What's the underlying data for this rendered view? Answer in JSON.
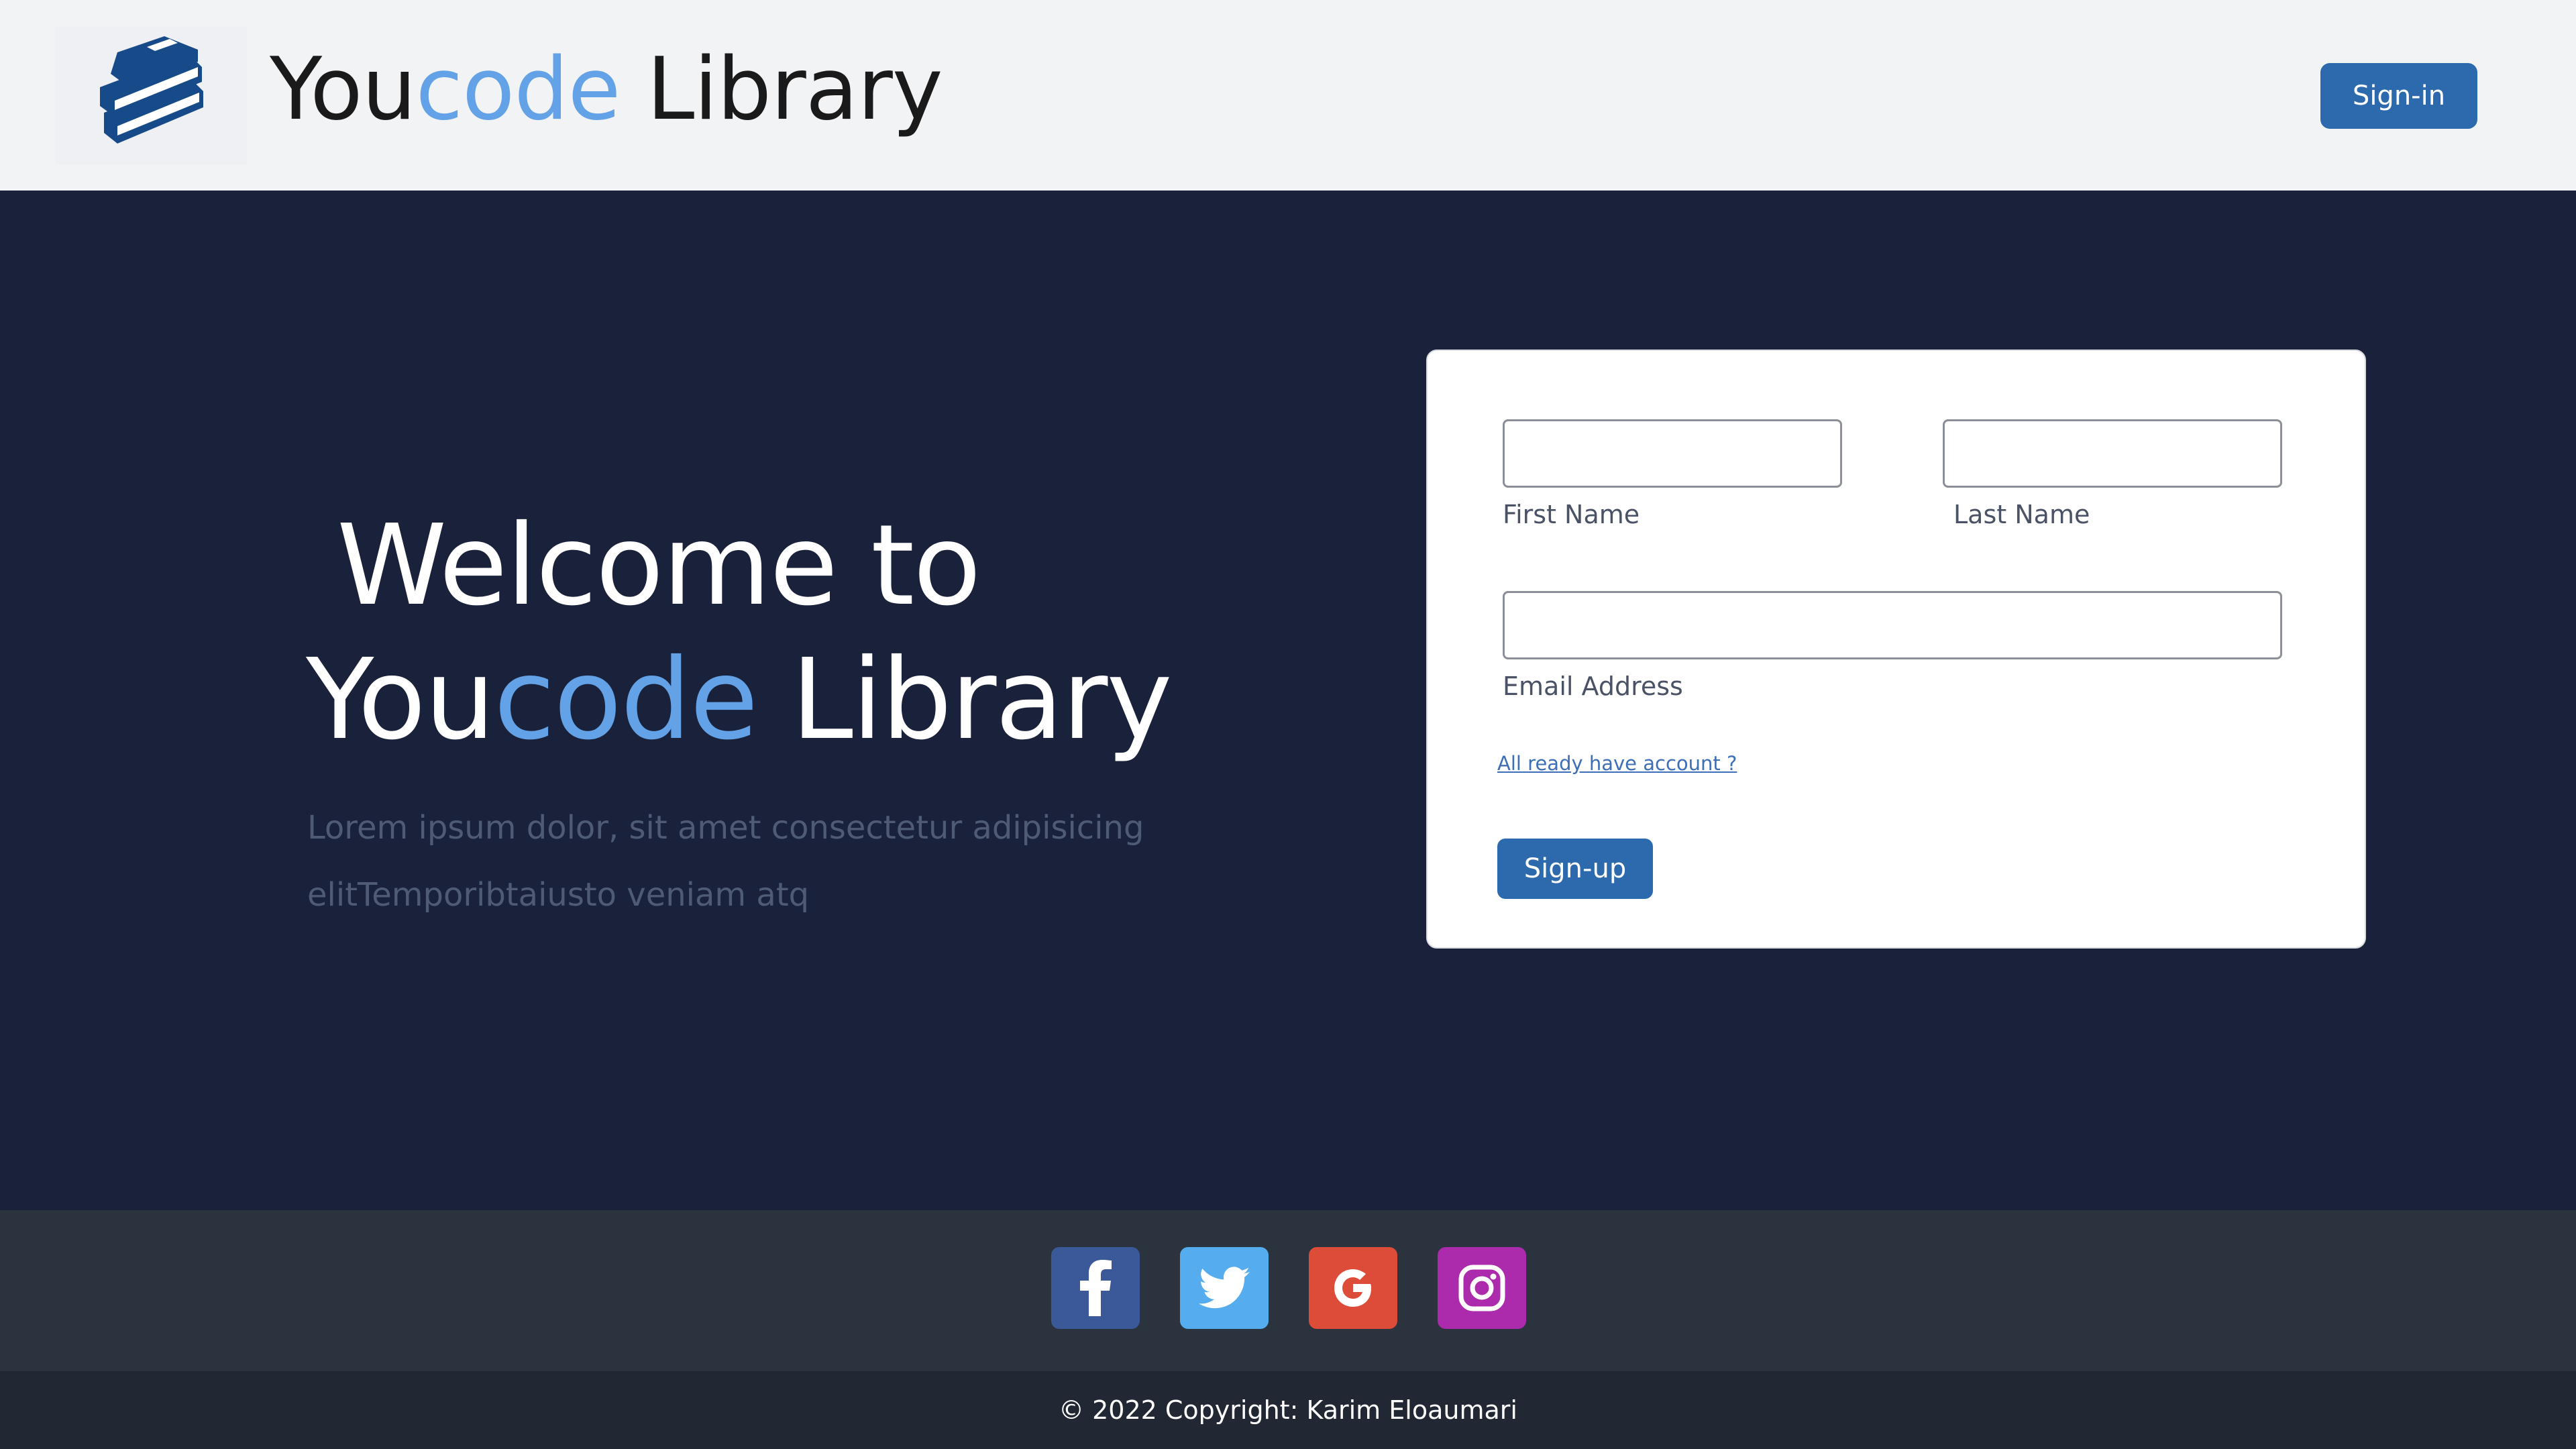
{
  "header": {
    "logo_icon": "book-stack-icon",
    "brand_part1": "You",
    "brand_part2": "code",
    "brand_part3": " Library",
    "signin_label": "Sign-in"
  },
  "hero": {
    "title_line1": "Welcome to",
    "title_part1": "You",
    "title_part2": "code",
    "title_part3": " Library",
    "description": "Lorem ipsum dolor, sit amet consectetur adipisicing elitTemporibtaiusto veniam atq"
  },
  "form": {
    "first_name_label": "First Name",
    "first_name_value": "",
    "last_name_label": "Last Name",
    "last_name_value": "",
    "email_label": "Email Address",
    "email_value": "",
    "already_link": "All ready have account ?",
    "signup_label": "Sign-up"
  },
  "social": {
    "icons": [
      "facebook-icon",
      "twitter-icon",
      "google-icon",
      "instagram-icon"
    ],
    "colors": {
      "facebook": "#3b5998",
      "twitter": "#55acee",
      "google": "#dd4b39",
      "instagram": "#ac2bac"
    }
  },
  "footer": {
    "copyright": "© 2022 Copyright: Karim Eloaumari"
  },
  "colors": {
    "accent": "#63a2e6",
    "primary_button": "#2c6aad",
    "hero_bg": "#19223a"
  }
}
